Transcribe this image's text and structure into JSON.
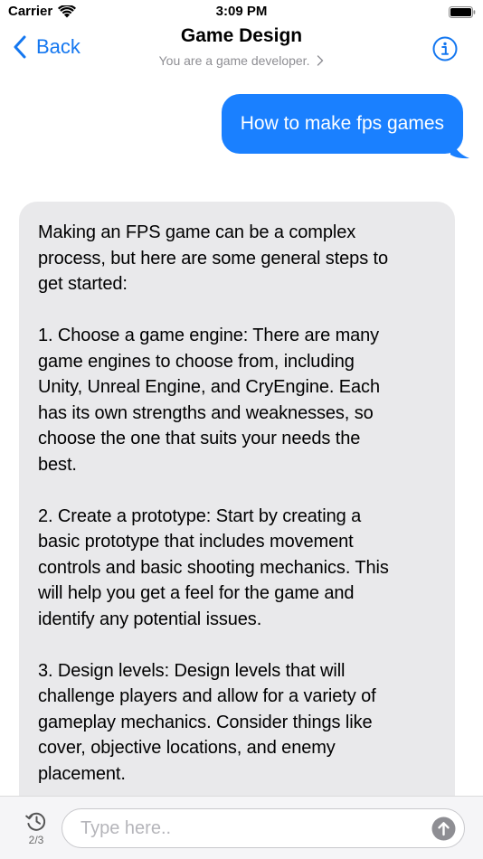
{
  "status_bar": {
    "carrier": "Carrier",
    "time": "3:09 PM"
  },
  "nav": {
    "back_label": "Back",
    "title": "Game Design",
    "subtitle": "You are a game developer.",
    "icons": [
      "chevron-left-icon",
      "info-icon",
      "chevron-right-icon"
    ]
  },
  "conversation": {
    "user_message": "How to make fps games",
    "assistant_paragraphs": [
      [
        "Making an FPS game can be a complex",
        "process, but here are some general steps to",
        "get started:"
      ],
      [
        "1. Choose a game engine: There are many",
        "game engines to choose from, including",
        "Unity, Unreal Engine, and CryEngine. Each",
        "has its own strengths and weaknesses, so",
        "choose the one that suits your needs the",
        "best."
      ],
      [
        "2. Create a prototype: Start by creating a",
        "basic prototype that includes movement",
        "controls and basic shooting mechanics. This",
        "will help you get a feel for the game and",
        "identify any potential issues."
      ],
      [
        "3. Design levels: Design levels that will",
        "challenge players and allow for a variety of",
        "gameplay mechanics. Consider things like",
        "cover, objective locations, and enemy",
        "placement."
      ]
    ]
  },
  "input_bar": {
    "history_count": "2/3",
    "placeholder": "Type here..",
    "value": ""
  },
  "colors": {
    "accent": "#1477f0",
    "user_bubble": "#1a80ff",
    "assistant_bubble": "#e9e9eb",
    "subtitle": "#8e8e93"
  }
}
